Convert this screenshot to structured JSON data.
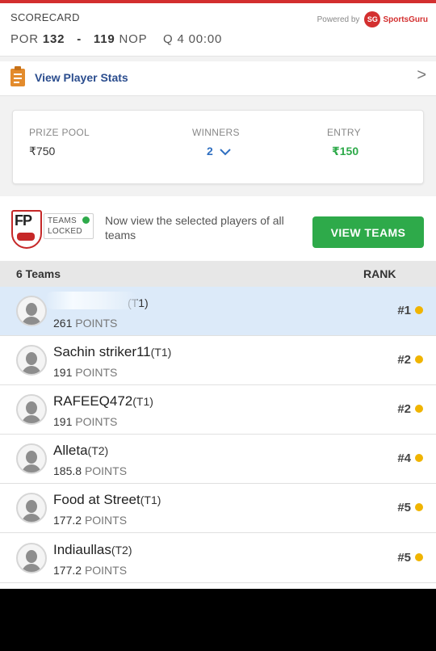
{
  "scorecard": {
    "title": "SCORECARD",
    "team1": "POR",
    "score1": "132",
    "separator": "-",
    "score2": "119",
    "team2": "NOP",
    "quarter": "Q 4",
    "clock": "00:00",
    "powered_by": "Powered by",
    "brand_logo": "SG",
    "brand_name": "SportsGuru"
  },
  "player_stats": {
    "label": "View Player Stats",
    "chevron": ">"
  },
  "contest": {
    "prize_pool_label": "PRIZE POOL",
    "prize_pool_value": "₹750",
    "winners_label": "WINNERS",
    "winners_value": "2",
    "entry_label": "ENTRY",
    "entry_value": "₹150"
  },
  "locked": {
    "badge_letters": "FP",
    "line1": "TEAMS",
    "line2": "LOCKED",
    "message": "Now view the selected players of all teams",
    "button_label": "VIEW TEAMS"
  },
  "teams_header": {
    "count_label": "6 Teams",
    "rank_label": "RANK"
  },
  "teams": [
    {
      "name": "",
      "tag": "(T1)",
      "points": "261",
      "points_label": "POINTS",
      "rank": "#1"
    },
    {
      "name": "Sachin striker11",
      "tag": "(T1)",
      "points": "191",
      "points_label": "POINTS",
      "rank": "#2"
    },
    {
      "name": "RAFEEQ472",
      "tag": "(T1)",
      "points": "191",
      "points_label": "POINTS",
      "rank": "#2"
    },
    {
      "name": "Alleta",
      "tag": "(T2)",
      "points": "185.8",
      "points_label": "POINTS",
      "rank": "#4"
    },
    {
      "name": "Food at Street",
      "tag": "(T1)",
      "points": "177.2",
      "points_label": "POINTS",
      "rank": "#5"
    },
    {
      "name": "Indiaullas",
      "tag": "(T2)",
      "points": "177.2",
      "points_label": "POINTS",
      "rank": "#5"
    }
  ],
  "colors": {
    "accent_red": "#d32f2f",
    "link_blue": "#2b4d8e",
    "green": "#2eaa4a",
    "highlight_row": "#dceaf9"
  }
}
